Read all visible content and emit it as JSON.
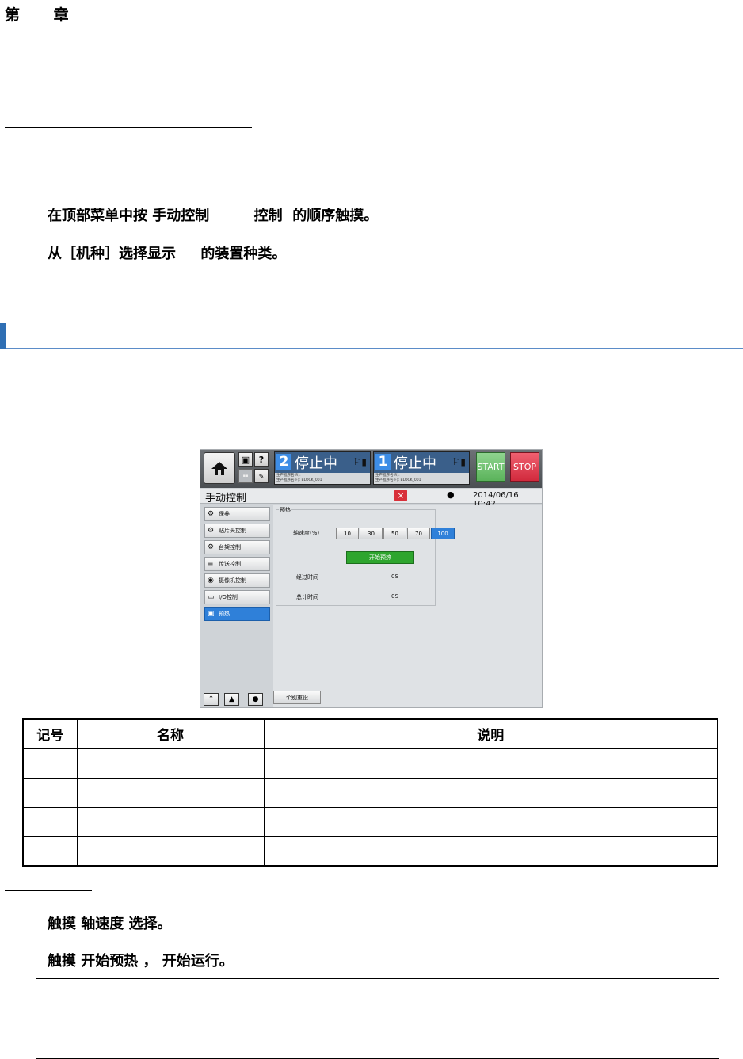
{
  "chapter_label": "第 章",
  "steps_intro": [
    "在顶部菜单中按 手动控制         控制  的顺序触摸。",
    "从［机种］选择显示     的装置种类。"
  ],
  "screen": {
    "home_icon": "home-icon",
    "help_label": "?",
    "lane2": {
      "num": "2",
      "label": "停止中",
      "line1": "生产程序名(R):",
      "line2": "生产程序名(F): BLOCK_001"
    },
    "lane1": {
      "num": "1",
      "label": "停止中",
      "line1": "生产程序名(R):",
      "line2": "生产程序名(F): BLOCK_001"
    },
    "start_label": "START",
    "stop_label": "STOP",
    "title": "手动控制",
    "close_label": "×",
    "datetime": "2014/06/16 10:42",
    "sidebar": [
      {
        "label": "保养",
        "icon": "⚙"
      },
      {
        "label": "贴片头控制",
        "icon": "⚙"
      },
      {
        "label": "台架控制",
        "icon": "⚙"
      },
      {
        "label": "传送控制",
        "icon": "≡"
      },
      {
        "label": "摄像机控制",
        "icon": "◉"
      },
      {
        "label": "I/O控制",
        "icon": "▭"
      },
      {
        "label": "预热",
        "icon": "▣"
      }
    ],
    "active_item": "预热",
    "group_title": "预热",
    "axis_speed_label": "轴速度(%)",
    "speed_options": [
      "10",
      "30",
      "50",
      "70",
      "100"
    ],
    "speed_selected": "100",
    "start_preheat_label": "开始预热",
    "elapsed_label": "经过时间",
    "elapsed_value": "0S",
    "total_label": "总计时间",
    "total_value": "0S",
    "reset_label": "个别重设"
  },
  "table": {
    "headers": [
      "记号",
      "名称",
      "说明"
    ],
    "rows": [
      [
        "",
        "",
        ""
      ],
      [
        "",
        "",
        ""
      ],
      [
        "",
        "",
        ""
      ],
      [
        "",
        "",
        ""
      ]
    ]
  },
  "steps_after": [
    "触摸 轴速度 选择。",
    "触摸 开始预热 ， 开始运行。"
  ]
}
